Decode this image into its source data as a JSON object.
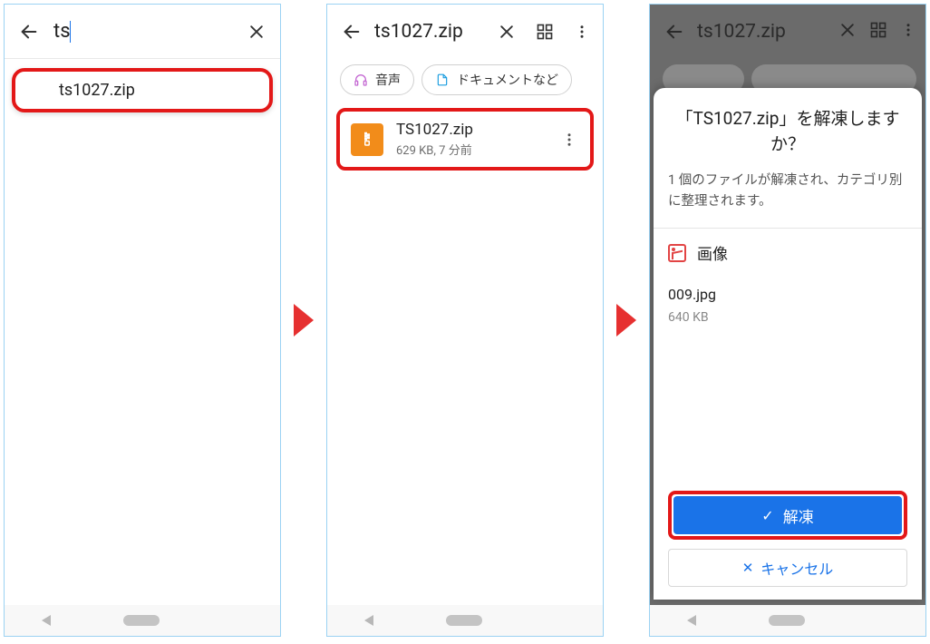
{
  "screen1": {
    "search_value": "ts",
    "result": "ts1027.zip"
  },
  "screen2": {
    "title": "ts1027.zip",
    "chips": {
      "audio": {
        "icon": "headphones-icon",
        "label": "音声"
      },
      "docs": {
        "icon": "document-icon",
        "label": "ドキュメントなど"
      }
    },
    "file": {
      "name": "TS1027.zip",
      "meta": "629 KB, 7 分前",
      "icon": "zip-icon"
    }
  },
  "screen3": {
    "dim_title": "ts1027.zip",
    "sheet_title": "「TS1027.zip」を解凍しますか？",
    "sheet_sub": "1 個のファイルが解凍され、カテゴリ別に整理されます。",
    "category_label": "画像",
    "item_name": "009.jpg",
    "item_size": "640 KB",
    "extract_label": "解凍",
    "cancel_label": "キャンセル"
  }
}
